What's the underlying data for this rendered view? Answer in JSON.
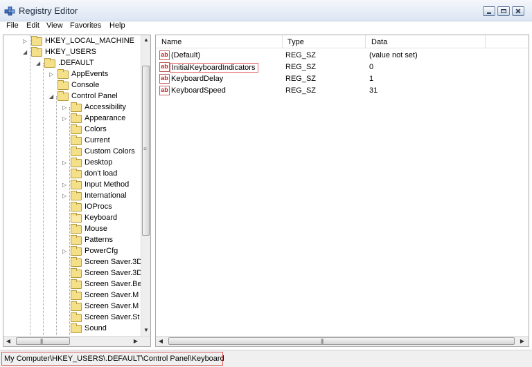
{
  "window": {
    "title": "Registry Editor"
  },
  "menu": [
    "File",
    "Edit",
    "View",
    "Favorites",
    "Help"
  ],
  "tree": {
    "items": [
      {
        "label": "HKEY_LOCAL_MACHINE",
        "level": 0,
        "expander": "collapsed"
      },
      {
        "label": "HKEY_USERS",
        "level": 0,
        "expander": "expanded"
      },
      {
        "label": ".DEFAULT",
        "level": 1,
        "expander": "expanded"
      },
      {
        "label": "AppEvents",
        "level": 2,
        "expander": "collapsed"
      },
      {
        "label": "Console",
        "level": 2,
        "expander": "none"
      },
      {
        "label": "Control Panel",
        "level": 2,
        "expander": "expanded"
      },
      {
        "label": "Accessibility",
        "level": 3,
        "expander": "collapsed"
      },
      {
        "label": "Appearance",
        "level": 3,
        "expander": "collapsed"
      },
      {
        "label": "Colors",
        "level": 3,
        "expander": "none"
      },
      {
        "label": "Current",
        "level": 3,
        "expander": "none"
      },
      {
        "label": "Custom Colors",
        "level": 3,
        "expander": "none"
      },
      {
        "label": "Desktop",
        "level": 3,
        "expander": "collapsed"
      },
      {
        "label": "don't load",
        "level": 3,
        "expander": "none"
      },
      {
        "label": "Input Method",
        "level": 3,
        "expander": "collapsed"
      },
      {
        "label": "International",
        "level": 3,
        "expander": "collapsed"
      },
      {
        "label": "IOProcs",
        "level": 3,
        "expander": "none"
      },
      {
        "label": "Keyboard",
        "level": 3,
        "expander": "none",
        "open": true
      },
      {
        "label": "Mouse",
        "level": 3,
        "expander": "none"
      },
      {
        "label": "Patterns",
        "level": 3,
        "expander": "none"
      },
      {
        "label": "PowerCfg",
        "level": 3,
        "expander": "collapsed"
      },
      {
        "label": "Screen Saver.3D",
        "level": 3,
        "expander": "none"
      },
      {
        "label": "Screen Saver.3D",
        "level": 3,
        "expander": "none"
      },
      {
        "label": "Screen Saver.Be",
        "level": 3,
        "expander": "none"
      },
      {
        "label": "Screen Saver.M",
        "level": 3,
        "expander": "none"
      },
      {
        "label": "Screen Saver.M",
        "level": 3,
        "expander": "none"
      },
      {
        "label": "Screen Saver.St",
        "level": 3,
        "expander": "none"
      },
      {
        "label": "Sound",
        "level": 3,
        "expander": "none"
      }
    ]
  },
  "list": {
    "headers": {
      "name": "Name",
      "type": "Type",
      "data": "Data"
    },
    "rows": [
      {
        "name": "(Default)",
        "type": "REG_SZ",
        "data": "(value not set)"
      },
      {
        "name": "InitialKeyboardIndicators",
        "type": "REG_SZ",
        "data": "0",
        "highlighted": true
      },
      {
        "name": "KeyboardDelay",
        "type": "REG_SZ",
        "data": "1"
      },
      {
        "name": "KeyboardSpeed",
        "type": "REG_SZ",
        "data": "31"
      }
    ]
  },
  "status": {
    "path": "My Computer\\HKEY_USERS\\.DEFAULT\\Control Panel\\Keyboard"
  },
  "colors": {
    "highlight_border": "#e06060",
    "folder": "#f5e08a"
  }
}
